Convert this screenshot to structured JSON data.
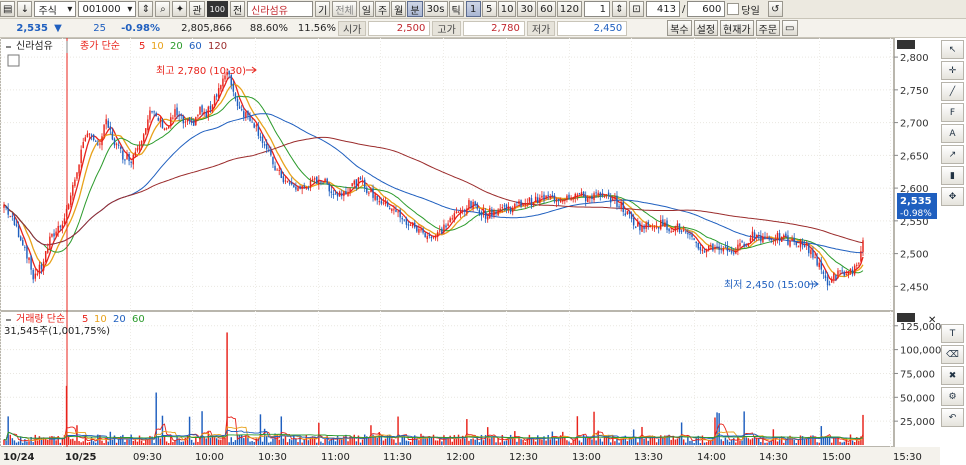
{
  "toolbar": {
    "market_type": "주식",
    "code": "001000",
    "btn_gwan": "관",
    "btn_jeon": "전",
    "chart_badge": "100",
    "stock_name": "신라섬유",
    "btn_gi": "기",
    "btn_all": "전체",
    "periods": [
      "일",
      "주",
      "월",
      "분",
      "30s",
      "틱"
    ],
    "active_period": "분",
    "minutes": [
      "1",
      "5",
      "10",
      "30",
      "60",
      "120"
    ],
    "active_minute": "1",
    "step_value": "1",
    "count_value": "413",
    "count_sep": "/",
    "count_total": "600",
    "today_label": "당일"
  },
  "quote": {
    "price": "2,535",
    "change_arrow": "▼",
    "change": "25",
    "change_pct": "-0.98%",
    "volume": "2,805,866",
    "ratio1": "88.60%",
    "ratio2": "11.56%",
    "open_label": "시가",
    "open": "2,500",
    "high_label": "고가",
    "high": "2,780",
    "low_label": "저가",
    "low": "2,450",
    "buttons": [
      "복수",
      "설정",
      "현재가",
      "주문"
    ]
  },
  "colors": {
    "up": "#e8231b",
    "down": "#1f5fbf",
    "ma5": "#e8231b",
    "ma10": "#e8a21b",
    "ma20": "#2c9b2c",
    "ma60": "#1f5fbf",
    "ma120": "#9b2c2c"
  },
  "price_panel": {
    "stock_label": "신라섬유",
    "legend_prefix": "종가 단순",
    "ma_periods": [
      "5",
      "10",
      "20",
      "60",
      "120"
    ],
    "high_annotation": "최고 2,780 (10:30)",
    "low_annotation": "최저 2,450 (15:00)",
    "last_price_tag": "2,535",
    "last_change_tag": "-0.98%"
  },
  "volume_panel": {
    "legend_prefix": "거래량 단순",
    "ma_periods": [
      "5",
      "10",
      "20",
      "60"
    ],
    "last_volume": "31,545주(1,001,75%)"
  },
  "chart_data": {
    "type": "candlestick",
    "price_ylim": [
      2420,
      2820
    ],
    "price_ticks": [
      "2,800",
      "2,750",
      "2,700",
      "2,650",
      "2,600",
      "2,550",
      "2,500",
      "2,450"
    ],
    "volume_ylim": [
      0,
      130000
    ],
    "volume_ticks": [
      "125,000",
      "100,000",
      "75,000",
      "50,000",
      "25,000"
    ],
    "x_ticks": [
      "10/24",
      "10/25",
      "09:30",
      "10:00",
      "10:30",
      "11:00",
      "11:30",
      "12:00",
      "12:30",
      "13:00",
      "13:30",
      "14:00",
      "14:30",
      "15:00",
      "15:30"
    ],
    "close_path": [
      [
        0,
        2575
      ],
      [
        5,
        2545
      ],
      [
        10,
        2510
      ],
      [
        14,
        2465
      ],
      [
        18,
        2480
      ],
      [
        22,
        2520
      ],
      [
        26,
        2540
      ],
      [
        29,
        2555
      ],
      [
        33,
        2600
      ],
      [
        37,
        2655
      ],
      [
        41,
        2690
      ],
      [
        45,
        2660
      ],
      [
        49,
        2700
      ],
      [
        53,
        2670
      ],
      [
        57,
        2650
      ],
      [
        61,
        2645
      ],
      [
        65,
        2670
      ],
      [
        70,
        2715
      ],
      [
        74,
        2705
      ],
      [
        78,
        2690
      ],
      [
        82,
        2715
      ],
      [
        86,
        2700
      ],
      [
        90,
        2695
      ],
      [
        94,
        2720
      ],
      [
        97,
        2710
      ],
      [
        101,
        2740
      ],
      [
        105,
        2765
      ],
      [
        108,
        2775
      ],
      [
        111,
        2735
      ],
      [
        115,
        2715
      ],
      [
        119,
        2705
      ],
      [
        123,
        2680
      ],
      [
        127,
        2650
      ],
      [
        131,
        2625
      ],
      [
        135,
        2610
      ],
      [
        139,
        2600
      ],
      [
        143,
        2600
      ],
      [
        147,
        2605
      ],
      [
        151,
        2615
      ],
      [
        155,
        2605
      ],
      [
        159,
        2590
      ],
      [
        163,
        2595
      ],
      [
        167,
        2605
      ],
      [
        171,
        2610
      ],
      [
        175,
        2595
      ],
      [
        179,
        2585
      ],
      [
        183,
        2575
      ],
      [
        187,
        2570
      ],
      [
        191,
        2550
      ],
      [
        195,
        2545
      ],
      [
        199,
        2535
      ],
      [
        203,
        2530
      ],
      [
        207,
        2525
      ],
      [
        211,
        2540
      ],
      [
        215,
        2555
      ],
      [
        219,
        2565
      ],
      [
        223,
        2575
      ],
      [
        227,
        2570
      ],
      [
        231,
        2560
      ],
      [
        235,
        2565
      ],
      [
        239,
        2570
      ],
      [
        243,
        2570
      ],
      [
        247,
        2575
      ],
      [
        251,
        2580
      ],
      [
        255,
        2580
      ],
      [
        259,
        2585
      ],
      [
        263,
        2585
      ],
      [
        267,
        2585
      ],
      [
        271,
        2590
      ],
      [
        275,
        2590
      ],
      [
        279,
        2585
      ],
      [
        283,
        2590
      ],
      [
        287,
        2585
      ],
      [
        291,
        2585
      ],
      [
        295,
        2575
      ],
      [
        299,
        2560
      ],
      [
        303,
        2545
      ],
      [
        307,
        2540
      ],
      [
        311,
        2545
      ],
      [
        315,
        2545
      ],
      [
        319,
        2540
      ],
      [
        323,
        2540
      ],
      [
        327,
        2530
      ],
      [
        331,
        2515
      ],
      [
        335,
        2505
      ],
      [
        339,
        2510
      ],
      [
        343,
        2510
      ],
      [
        347,
        2505
      ],
      [
        351,
        2505
      ],
      [
        355,
        2515
      ],
      [
        359,
        2530
      ],
      [
        363,
        2525
      ],
      [
        367,
        2525
      ],
      [
        371,
        2525
      ],
      [
        375,
        2520
      ],
      [
        379,
        2515
      ],
      [
        383,
        2515
      ],
      [
        387,
        2505
      ],
      [
        391,
        2480
      ],
      [
        395,
        2455
      ],
      [
        398,
        2465
      ],
      [
        401,
        2470
      ],
      [
        404,
        2470
      ],
      [
        407,
        2475
      ],
      [
        410,
        2480
      ],
      [
        413,
        2535
      ]
    ],
    "candle_count": 413,
    "volume_bar_count": 413
  },
  "right_tools": [
    "cursor-icon",
    "crosshair-icon",
    "trendline-icon",
    "fibonacci-icon",
    "auto-icon",
    "arrow-tool-icon",
    "candle-type-icon",
    "move-icon",
    "text-tool-icon",
    "erase-icon",
    "delete-all-icon",
    "settings-icon",
    "undo-icon"
  ]
}
